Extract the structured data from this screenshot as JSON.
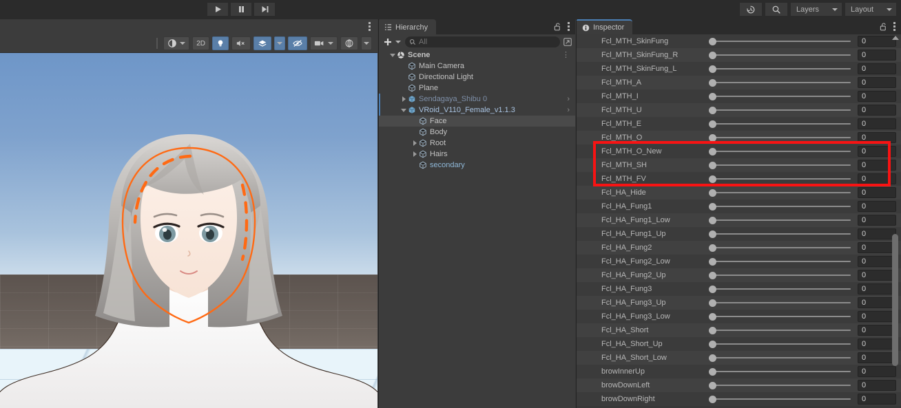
{
  "toolbar": {
    "play_label": "Play",
    "pause_label": "Pause",
    "step_label": "Step",
    "history_icon": "history-icon",
    "search_icon": "search-icon",
    "layers_label": "Layers",
    "layout_label": "Layout"
  },
  "scene": {
    "toolbar": {
      "shading_label": "Shading Mode",
      "two_d_label": "2D",
      "lighting_label": "Lighting",
      "audio_label": "Audio",
      "effects_label": "Effects",
      "hidden_label": "Hidden Objects",
      "camera_label": "Scene Camera",
      "gizmos_label": "Gizmos"
    },
    "selection_outline_color": "#ff6a14",
    "sky_color": "#7fa2cd",
    "ground_color": "#6b625c",
    "plane_color": "#e8f4fa"
  },
  "hierarchy": {
    "tab_label": "Hierarchy",
    "lock_icon": "lock-open-icon",
    "menu_icon": "kebab-menu-icon",
    "add_label": "+",
    "search_placeholder": "All",
    "search_value": "",
    "window_icon": "open-window-icon",
    "items": [
      {
        "label": "Scene",
        "indent": 0,
        "twisty": "down",
        "icon": "unity-scene-icon",
        "style": "bold",
        "chevron": false,
        "selbar": false,
        "selected": false,
        "kebab": true
      },
      {
        "label": "Main Camera",
        "indent": 1,
        "twisty": "none",
        "icon": "gameobject-icon",
        "style": "normal",
        "chevron": false,
        "selbar": false,
        "selected": false,
        "kebab": false
      },
      {
        "label": "Directional Light",
        "indent": 1,
        "twisty": "none",
        "icon": "gameobject-icon",
        "style": "normal",
        "chevron": false,
        "selbar": false,
        "selected": false,
        "kebab": false
      },
      {
        "label": "Plane",
        "indent": 1,
        "twisty": "none",
        "icon": "gameobject-icon",
        "style": "normal",
        "chevron": false,
        "selbar": false,
        "selected": false,
        "kebab": false
      },
      {
        "label": "Sendagaya_Shibu 0",
        "indent": 1,
        "twisty": "right",
        "icon": "prefab-icon",
        "style": "dim",
        "chevron": true,
        "selbar": true,
        "selected": false,
        "kebab": false
      },
      {
        "label": "VRoid_V110_Female_v1.1.3",
        "indent": 1,
        "twisty": "down",
        "icon": "prefab-icon",
        "style": "blue",
        "chevron": true,
        "selbar": true,
        "selected": false,
        "kebab": false
      },
      {
        "label": "Face",
        "indent": 2,
        "twisty": "none",
        "icon": "gameobject-icon",
        "style": "normal",
        "chevron": false,
        "selbar": false,
        "selected": true,
        "kebab": false
      },
      {
        "label": "Body",
        "indent": 2,
        "twisty": "none",
        "icon": "gameobject-icon",
        "style": "normal",
        "chevron": false,
        "selbar": false,
        "selected": false,
        "kebab": false
      },
      {
        "label": "Root",
        "indent": 2,
        "twisty": "right",
        "icon": "gameobject-icon",
        "style": "normal",
        "chevron": false,
        "selbar": false,
        "selected": false,
        "kebab": false
      },
      {
        "label": "Hairs",
        "indent": 2,
        "twisty": "right",
        "icon": "gameobject-icon",
        "style": "normal",
        "chevron": false,
        "selbar": false,
        "selected": false,
        "kebab": false
      },
      {
        "label": "secondary",
        "indent": 2,
        "twisty": "none",
        "icon": "gameobject-icon",
        "style": "cyan",
        "chevron": false,
        "selbar": false,
        "selected": false,
        "kebab": false
      }
    ]
  },
  "inspector": {
    "tab_label": "Inspector",
    "tab_icon": "info-icon",
    "lock_icon": "lock-open-icon",
    "menu_icon": "kebab-menu-icon",
    "highlight_color": "#f81313",
    "highlight_rows": [
      "Fcl_MTH_O_New",
      "Fcl_MTH_SH",
      "Fcl_MTH_FV"
    ],
    "properties": [
      {
        "label": "Fcl_MTH_SkinFung",
        "value": "0"
      },
      {
        "label": "Fcl_MTH_SkinFung_R",
        "value": "0"
      },
      {
        "label": "Fcl_MTH_SkinFung_L",
        "value": "0"
      },
      {
        "label": "Fcl_MTH_A",
        "value": "0"
      },
      {
        "label": "Fcl_MTH_I",
        "value": "0"
      },
      {
        "label": "Fcl_MTH_U",
        "value": "0"
      },
      {
        "label": "Fcl_MTH_E",
        "value": "0"
      },
      {
        "label": "Fcl_MTH_O",
        "value": "0"
      },
      {
        "label": "Fcl_MTH_O_New",
        "value": "0"
      },
      {
        "label": "Fcl_MTH_SH",
        "value": "0"
      },
      {
        "label": "Fcl_MTH_FV",
        "value": "0"
      },
      {
        "label": "Fcl_HA_Hide",
        "value": "0"
      },
      {
        "label": "Fcl_HA_Fung1",
        "value": "0"
      },
      {
        "label": "Fcl_HA_Fung1_Low",
        "value": "0"
      },
      {
        "label": "Fcl_HA_Fung1_Up",
        "value": "0"
      },
      {
        "label": "Fcl_HA_Fung2",
        "value": "0"
      },
      {
        "label": "Fcl_HA_Fung2_Low",
        "value": "0"
      },
      {
        "label": "Fcl_HA_Fung2_Up",
        "value": "0"
      },
      {
        "label": "Fcl_HA_Fung3",
        "value": "0"
      },
      {
        "label": "Fcl_HA_Fung3_Up",
        "value": "0"
      },
      {
        "label": "Fcl_HA_Fung3_Low",
        "value": "0"
      },
      {
        "label": "Fcl_HA_Short",
        "value": "0"
      },
      {
        "label": "Fcl_HA_Short_Up",
        "value": "0"
      },
      {
        "label": "Fcl_HA_Short_Low",
        "value": "0"
      },
      {
        "label": "browInnerUp",
        "value": "0"
      },
      {
        "label": "browDownLeft",
        "value": "0"
      },
      {
        "label": "browDownRight",
        "value": "0"
      }
    ]
  }
}
